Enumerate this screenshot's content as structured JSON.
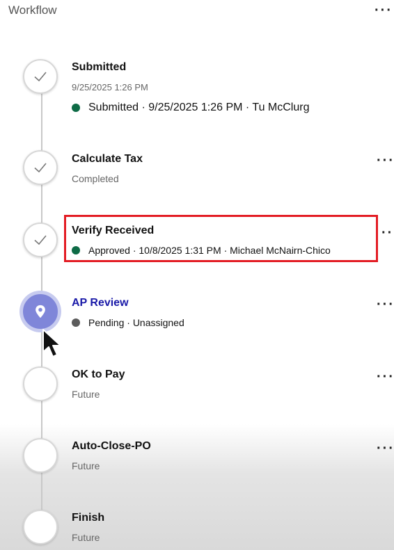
{
  "header": {
    "title": "Workflow",
    "menu_icon": "more-horizontal-icon"
  },
  "steps": [
    {
      "title": "Submitted",
      "subtitle": "9/25/2025 1:26 PM",
      "state": "done",
      "status_text": "Submitted · 9/25/2025 1:26 PM · Tu McClurg",
      "status_color": "#0e6b46"
    },
    {
      "title": "Calculate Tax",
      "subtitle": "Completed",
      "state": "done"
    },
    {
      "title": "Verify Received",
      "state": "done",
      "status_text": "Approved · 10/8/2025 1:31 PM · Michael McNairn-Chico",
      "status_color": "#0e6b46",
      "highlighted": true
    },
    {
      "title": "AP Review",
      "state": "current",
      "status_text": "Pending · Unassigned",
      "status_color": "#5c5c5c"
    },
    {
      "title": "OK to Pay",
      "subtitle": "Future",
      "state": "future"
    },
    {
      "title": "Auto-Close-PO",
      "subtitle": "Future",
      "state": "future"
    },
    {
      "title": "Finish",
      "subtitle": "Future",
      "state": "future"
    }
  ],
  "colors": {
    "accent": "#1a1aa8",
    "current_circle": "#7f86d9",
    "highlight": "#e31c24",
    "approved": "#0e6b46",
    "pending": "#5c5c5c"
  },
  "icons": {
    "done": "check-icon",
    "current": "location-pin-icon",
    "more": "more-horizontal-icon",
    "cursor": "mouse-pointer-icon"
  }
}
